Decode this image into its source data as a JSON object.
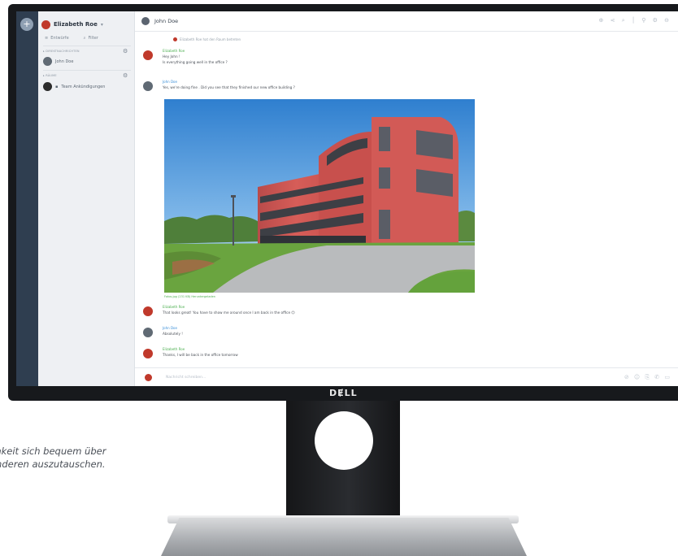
{
  "caption": {
    "line1": "chkeit sich bequem über",
    "line2": "anderen auszutauschen."
  },
  "monitor": {
    "brand": "DɆLL"
  },
  "app": {
    "rail": {
      "add_icon": "+"
    },
    "sidebar": {
      "user_name": "Elizabeth Roe",
      "tools": [
        {
          "icon": "list-icon",
          "label": "Entwürfe"
        },
        {
          "icon": "search-icon",
          "label": "Filter"
        }
      ],
      "sections": [
        {
          "title": "DIREKTNACHRICHTEN",
          "items": [
            {
              "label": "John Doe"
            }
          ]
        },
        {
          "title": "RÄUME",
          "items": [
            {
              "label": "Team Ankündigungen"
            }
          ]
        }
      ]
    },
    "chat": {
      "title": "John Doe",
      "top_icons": "⊕ ⋖ ⌕ │ ⚲ ⚙ ⊖",
      "notice": "Elizabeth Roe hat den Raum betreten",
      "messages": [
        {
          "author": "Elizabeth Roe",
          "lines": [
            "Hey John !",
            "Is everything going well in the office ?"
          ]
        },
        {
          "author": "John Doe",
          "lines": [
            "Yes, we're doing fine . Did you see that they finished our new office building ?"
          ]
        },
        {
          "author": "Elizabeth Roe",
          "lines": [
            "That looks great! You have to show me around once I am back in the office 😊"
          ]
        },
        {
          "author": "John Doe",
          "lines": [
            "Absolutely !"
          ]
        },
        {
          "author": "Elizabeth Roe",
          "lines": [
            "Thanks, I will be back in the office tomorrow"
          ]
        }
      ],
      "image_caption": "Fotos.jpg (231 KB) Heruntergeladen",
      "composer_placeholder": "Nachricht schreiben...",
      "composer_icons": "⊘ ☺ ⎘ ✆ ▭"
    }
  }
}
